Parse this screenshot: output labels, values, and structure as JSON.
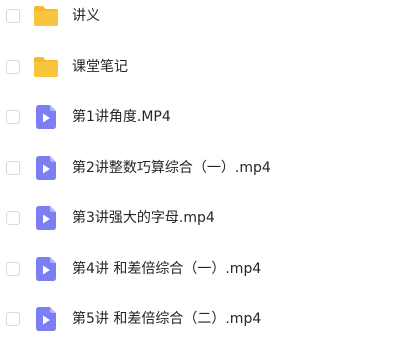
{
  "files": [
    {
      "name": "讲义",
      "type": "folder",
      "icon": "folder-icon"
    },
    {
      "name": "课堂笔记",
      "type": "folder",
      "icon": "folder-icon"
    },
    {
      "name": "第1讲角度.MP4",
      "type": "video",
      "icon": "video-file-icon"
    },
    {
      "name": "第2讲整数巧算综合（一）.mp4",
      "type": "video",
      "icon": "video-file-icon"
    },
    {
      "name": "第3讲强大的字母.mp4",
      "type": "video",
      "icon": "video-file-icon"
    },
    {
      "name": "第4讲 和差倍综合（一）.mp4",
      "type": "video",
      "icon": "video-file-icon"
    },
    {
      "name": "第5讲 和差倍综合（二）.mp4",
      "type": "video",
      "icon": "video-file-icon"
    }
  ],
  "colors": {
    "folder": "#f9c43e",
    "folder_tab": "#f5b92c",
    "video": "#7b7ff3",
    "video_fold": "#b3b5fa",
    "text": "#25262b",
    "checkbox_border": "#d6d9de"
  }
}
